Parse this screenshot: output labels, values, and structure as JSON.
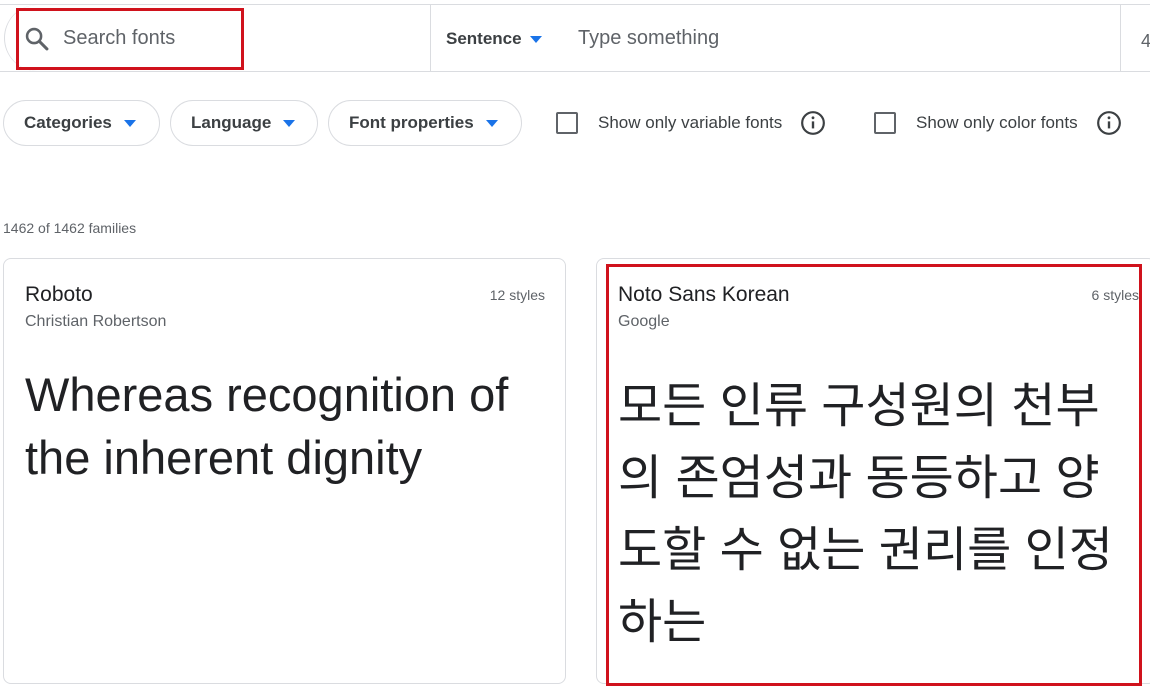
{
  "search": {
    "placeholder": "Search fonts",
    "value": ""
  },
  "preview": {
    "mode_label": "Sentence",
    "placeholder": "Type something",
    "size_value": "4"
  },
  "filters": {
    "categories_label": "Categories",
    "language_label": "Language",
    "properties_label": "Font properties",
    "variable_label": "Show only variable fonts",
    "color_label": "Show only color fonts"
  },
  "results": {
    "count_text": "1462 of 1462 families"
  },
  "cards": [
    {
      "name": "Roboto",
      "designer": "Christian Robertson",
      "styles": "12 styles",
      "sample": "Whereas recognition of the inherent dignity"
    },
    {
      "name": "Noto Sans Korean",
      "designer": "Google",
      "styles": "6 styles",
      "sample": "모든 인류 구성원의 천부의 존엄성과 동등하고 양도할 수 없는 권리를 인정하는"
    }
  ],
  "colors": {
    "accent": "#1a73e8",
    "highlight": "#d0121c",
    "border": "#dadce0",
    "muted": "#5f6368"
  },
  "icons": {
    "search": "search-icon",
    "caret": "caret-down-icon",
    "info": "info-icon"
  }
}
